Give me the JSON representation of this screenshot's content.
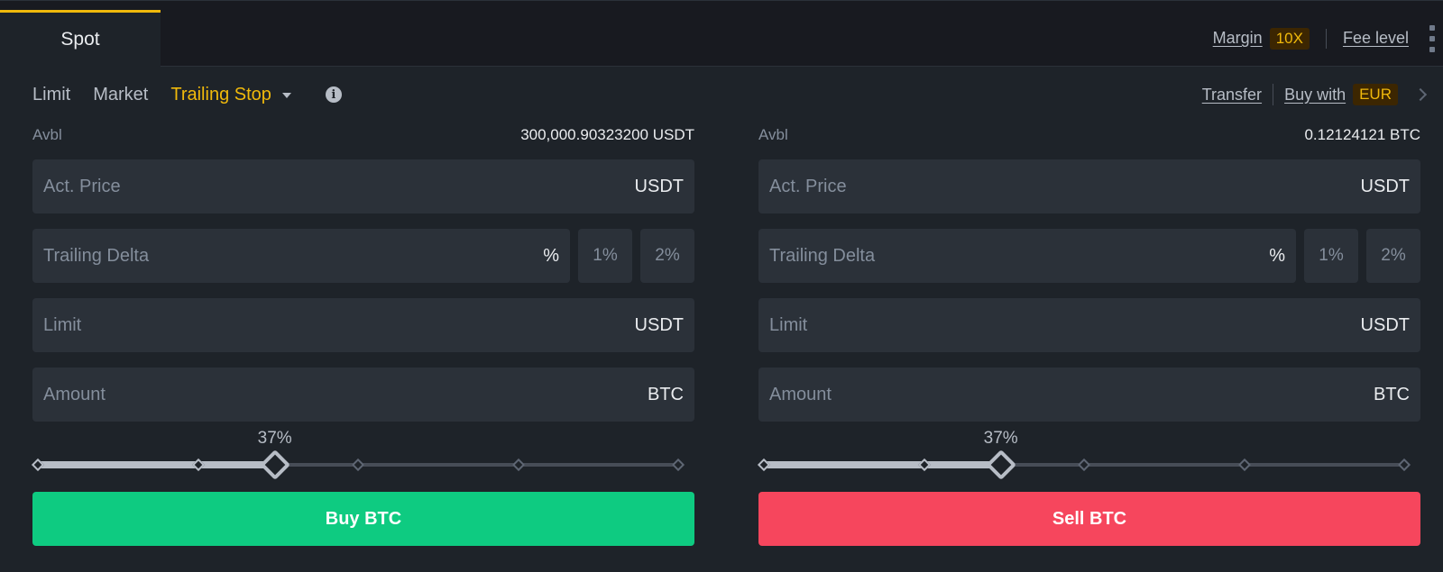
{
  "header": {
    "tab_spot": "Spot",
    "margin_label": "Margin",
    "margin_badge": "10X",
    "fee_level_label": "Fee level"
  },
  "order_types": {
    "items": [
      "Limit",
      "Market"
    ],
    "active": "Trailing Stop"
  },
  "links": {
    "transfer": "Transfer",
    "buy_with": "Buy with",
    "buy_with_badge": "EUR"
  },
  "colors": {
    "accent": "#f0b90b",
    "buy": "#0ecb81",
    "sell": "#f6465d"
  },
  "buy": {
    "avbl_label": "Avbl",
    "avbl_value": "300,000.90323200 USDT",
    "act_price_placeholder": "Act. Price",
    "act_price_unit": "USDT",
    "trailing_delta_placeholder": "Trailing Delta",
    "trailing_delta_unit": "%",
    "delta_presets": [
      "1%",
      "2%"
    ],
    "limit_placeholder": "Limit",
    "limit_unit": "USDT",
    "amount_placeholder": "Amount",
    "amount_unit": "BTC",
    "slider_percent": 37,
    "slider_label": "37%",
    "button_label": "Buy BTC"
  },
  "sell": {
    "avbl_label": "Avbl",
    "avbl_value": "0.12124121 BTC",
    "act_price_placeholder": "Act. Price",
    "act_price_unit": "USDT",
    "trailing_delta_placeholder": "Trailing Delta",
    "trailing_delta_unit": "%",
    "delta_presets": [
      "1%",
      "2%"
    ],
    "limit_placeholder": "Limit",
    "limit_unit": "USDT",
    "amount_placeholder": "Amount",
    "amount_unit": "BTC",
    "slider_percent": 37,
    "slider_label": "37%",
    "button_label": "Sell BTC"
  }
}
